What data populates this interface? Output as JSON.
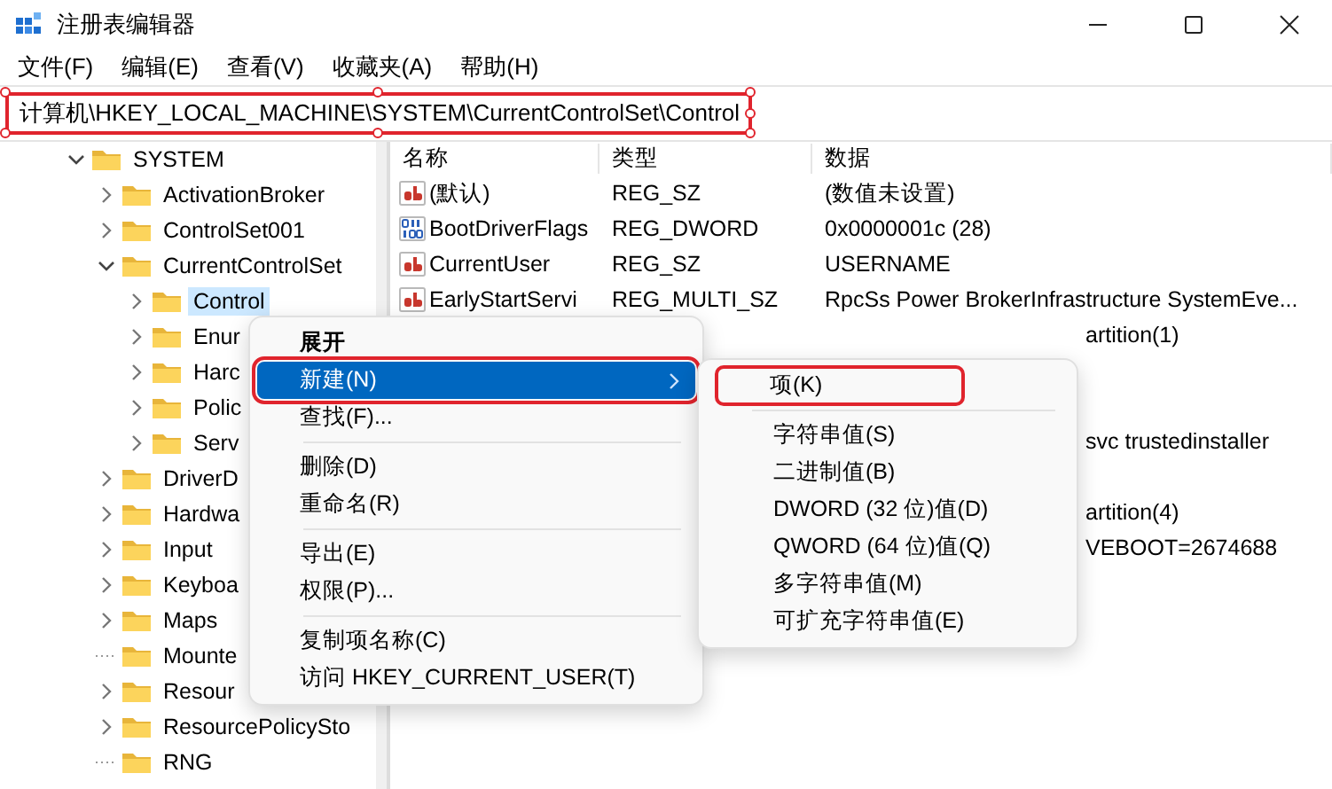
{
  "window": {
    "title": "注册表编辑器"
  },
  "menu_bar": [
    "文件(F)",
    "编辑(E)",
    "查看(V)",
    "收藏夹(A)",
    "帮助(H)"
  ],
  "address_bar": {
    "path": "计算机\\HKEY_LOCAL_MACHINE\\SYSTEM\\CurrentControlSet\\Control",
    "highlighted": true
  },
  "tree": [
    {
      "label": "SYSTEM",
      "has_children": true,
      "expanded": true,
      "selected": false,
      "children": [
        {
          "label": "ActivationBroker",
          "has_children": true,
          "expanded": false,
          "selected": false
        },
        {
          "label": "ControlSet001",
          "has_children": true,
          "expanded": false,
          "selected": false
        },
        {
          "label": "CurrentControlSet",
          "has_children": true,
          "expanded": true,
          "selected": false,
          "children": [
            {
              "label": "Control",
              "has_children": true,
              "expanded": false,
              "selected": true
            },
            {
              "label": "Enur",
              "has_children": true,
              "expanded": false,
              "selected": false
            },
            {
              "label": "Harc",
              "has_children": true,
              "expanded": false,
              "selected": false
            },
            {
              "label": "Polic",
              "has_children": true,
              "expanded": false,
              "selected": false
            },
            {
              "label": "Serv",
              "has_children": true,
              "expanded": false,
              "selected": false
            }
          ]
        },
        {
          "label": "DriverD",
          "has_children": true,
          "expanded": false,
          "selected": false
        },
        {
          "label": "Hardwa",
          "has_children": true,
          "expanded": false,
          "selected": false
        },
        {
          "label": "Input",
          "has_children": true,
          "expanded": false,
          "selected": false
        },
        {
          "label": "Keyboa",
          "has_children": true,
          "expanded": false,
          "selected": false
        },
        {
          "label": "Maps",
          "has_children": true,
          "expanded": false,
          "selected": false
        },
        {
          "label": "Mounte",
          "has_children": false,
          "selected": false
        },
        {
          "label": "Resour",
          "has_children": true,
          "expanded": false,
          "selected": false
        },
        {
          "label": "ResourcePolicySto",
          "has_children": true,
          "expanded": false,
          "selected": false
        },
        {
          "label": "RNG",
          "has_children": false,
          "selected": false
        }
      ]
    }
  ],
  "values": {
    "columns": [
      "名称",
      "类型",
      "数据"
    ],
    "rows": [
      {
        "kind": "string",
        "name": "(默认)",
        "type": "REG_SZ",
        "data": "(数值未设置)"
      },
      {
        "kind": "binary",
        "name": "BootDriverFlags",
        "type": "REG_DWORD",
        "data": "0x0000001c (28)"
      },
      {
        "kind": "string",
        "name": "CurrentUser",
        "type": "REG_SZ",
        "data": "USERNAME"
      },
      {
        "kind": "string",
        "name": "EarlyStartServi",
        "type": "REG_MULTI_SZ",
        "data": "RpcSs Power BrokerInfrastructure SystemEve..."
      },
      {
        "kind": "covered",
        "data": "artition(1)"
      },
      {
        "kind": "hidden"
      },
      {
        "kind": "hidden"
      },
      {
        "kind": "covered",
        "data": "svc trustedinstaller"
      },
      {
        "kind": "hidden"
      },
      {
        "kind": "covered",
        "data": "artition(4)"
      },
      {
        "kind": "covered",
        "data": "VEBOOT=2674688"
      }
    ]
  },
  "context_menu": {
    "items": [
      {
        "kind": "item",
        "label": "展开",
        "bold": true,
        "selected": false,
        "submenu": false,
        "highlighted": false
      },
      {
        "kind": "item",
        "label": "新建(N)",
        "bold": false,
        "selected": true,
        "submenu": true,
        "highlighted": true
      },
      {
        "kind": "item",
        "label": "查找(F)...",
        "bold": false,
        "selected": false,
        "submenu": false,
        "highlighted": false
      },
      {
        "kind": "separator"
      },
      {
        "kind": "item",
        "label": "删除(D)",
        "bold": false,
        "selected": false,
        "submenu": false,
        "highlighted": false
      },
      {
        "kind": "item",
        "label": "重命名(R)",
        "bold": false,
        "selected": false,
        "submenu": false,
        "highlighted": false
      },
      {
        "kind": "separator"
      },
      {
        "kind": "item",
        "label": "导出(E)",
        "bold": false,
        "selected": false,
        "submenu": false,
        "highlighted": false
      },
      {
        "kind": "item",
        "label": "权限(P)...",
        "bold": false,
        "selected": false,
        "submenu": false,
        "highlighted": false
      },
      {
        "kind": "separator"
      },
      {
        "kind": "item",
        "label": "复制项名称(C)",
        "bold": false,
        "selected": false,
        "submenu": false,
        "highlighted": false
      },
      {
        "kind": "item",
        "label": "访问 HKEY_CURRENT_USER(T)",
        "bold": false,
        "selected": false,
        "submenu": false,
        "highlighted": false
      }
    ]
  },
  "submenu": {
    "items": [
      {
        "kind": "item",
        "label": "项(K)",
        "bold": false,
        "selected": false,
        "submenu": false,
        "highlighted": true
      },
      {
        "kind": "separator"
      },
      {
        "kind": "item",
        "label": "字符串值(S)",
        "bold": false,
        "selected": false,
        "submenu": false,
        "highlighted": false
      },
      {
        "kind": "item",
        "label": "二进制值(B)",
        "bold": false,
        "selected": false,
        "submenu": false,
        "highlighted": false
      },
      {
        "kind": "item",
        "label": "DWORD (32 位)值(D)",
        "bold": false,
        "selected": false,
        "submenu": false,
        "highlighted": false
      },
      {
        "kind": "item",
        "label": "QWORD (64 位)值(Q)",
        "bold": false,
        "selected": false,
        "submenu": false,
        "highlighted": false
      },
      {
        "kind": "item",
        "label": "多字符串值(M)",
        "bold": false,
        "selected": false,
        "submenu": false,
        "highlighted": false
      },
      {
        "kind": "item",
        "label": "可扩充字符串值(E)",
        "bold": false,
        "selected": false,
        "submenu": false,
        "highlighted": false
      }
    ]
  }
}
